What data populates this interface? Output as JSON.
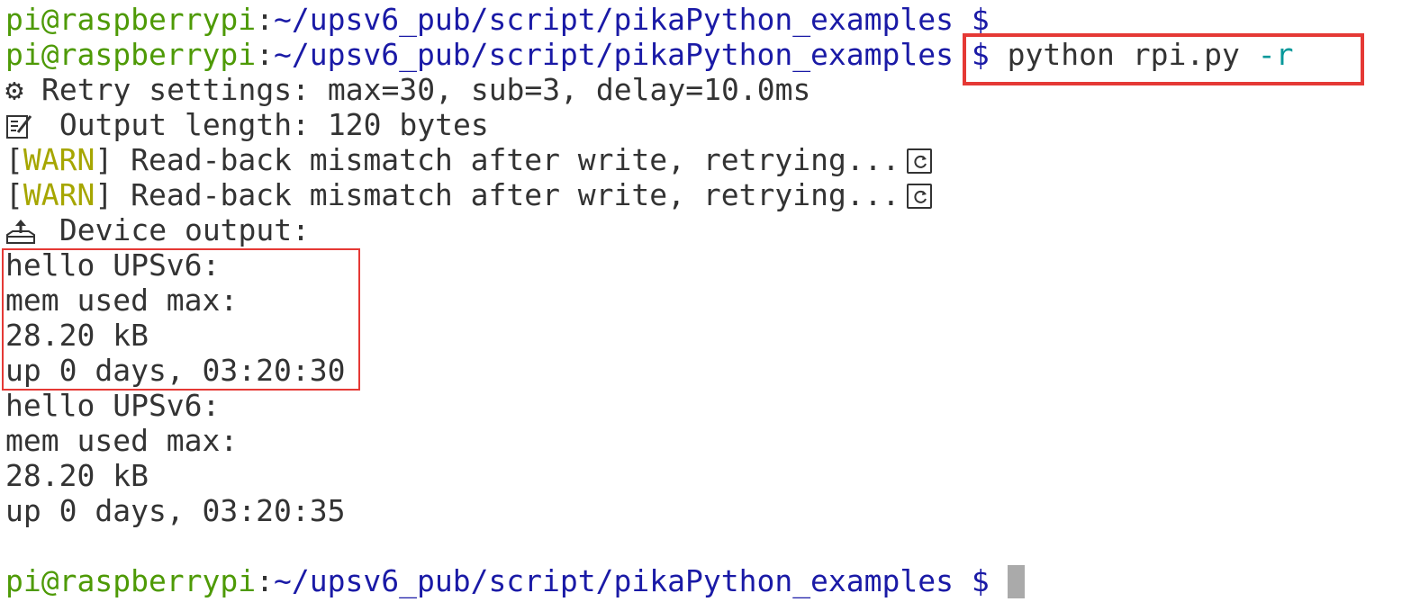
{
  "prompt": {
    "user_host": "pi@raspberrypi",
    "colon": ":",
    "path": "~/upsv6_pub/script/pikaPython_examples",
    "symbol": "$"
  },
  "command": {
    "program": "python rpi.py",
    "flag": "-r"
  },
  "retry_line": {
    "icon": "gear-icon",
    "text": "Retry settings: max=30, sub=3, delay=10.0ms"
  },
  "output_length_line": {
    "icon": "memo-icon",
    "text": "Output length: 120 bytes"
  },
  "warnings": [
    {
      "open_bracket": "[",
      "tag": "WARN",
      "close_bracket": "]",
      "message": "Read-back mismatch after write, retrying...",
      "icon": "retry-icon"
    },
    {
      "open_bracket": "[",
      "tag": "WARN",
      "close_bracket": "]",
      "message": "Read-back mismatch after write, retrying...",
      "icon": "retry-icon"
    }
  ],
  "device_output_header": {
    "icon": "outbox-tray-icon",
    "text": "Device output:"
  },
  "output_blocks": [
    {
      "greeting": "hello UPSv6:",
      "mem_label": "mem used max:",
      "mem_value": "28.20 kB",
      "uptime": "up 0 days, 03:20:30"
    },
    {
      "greeting": "hello UPSv6:",
      "mem_label": "mem used max:",
      "mem_value": "28.20 kB",
      "uptime": "up 0 days, 03:20:35"
    }
  ],
  "colors": {
    "user_host": "#4e9a06",
    "path": "#1a1aa6",
    "warn": "#a6a600",
    "flag": "#06989a",
    "highlight": "#e53935"
  }
}
